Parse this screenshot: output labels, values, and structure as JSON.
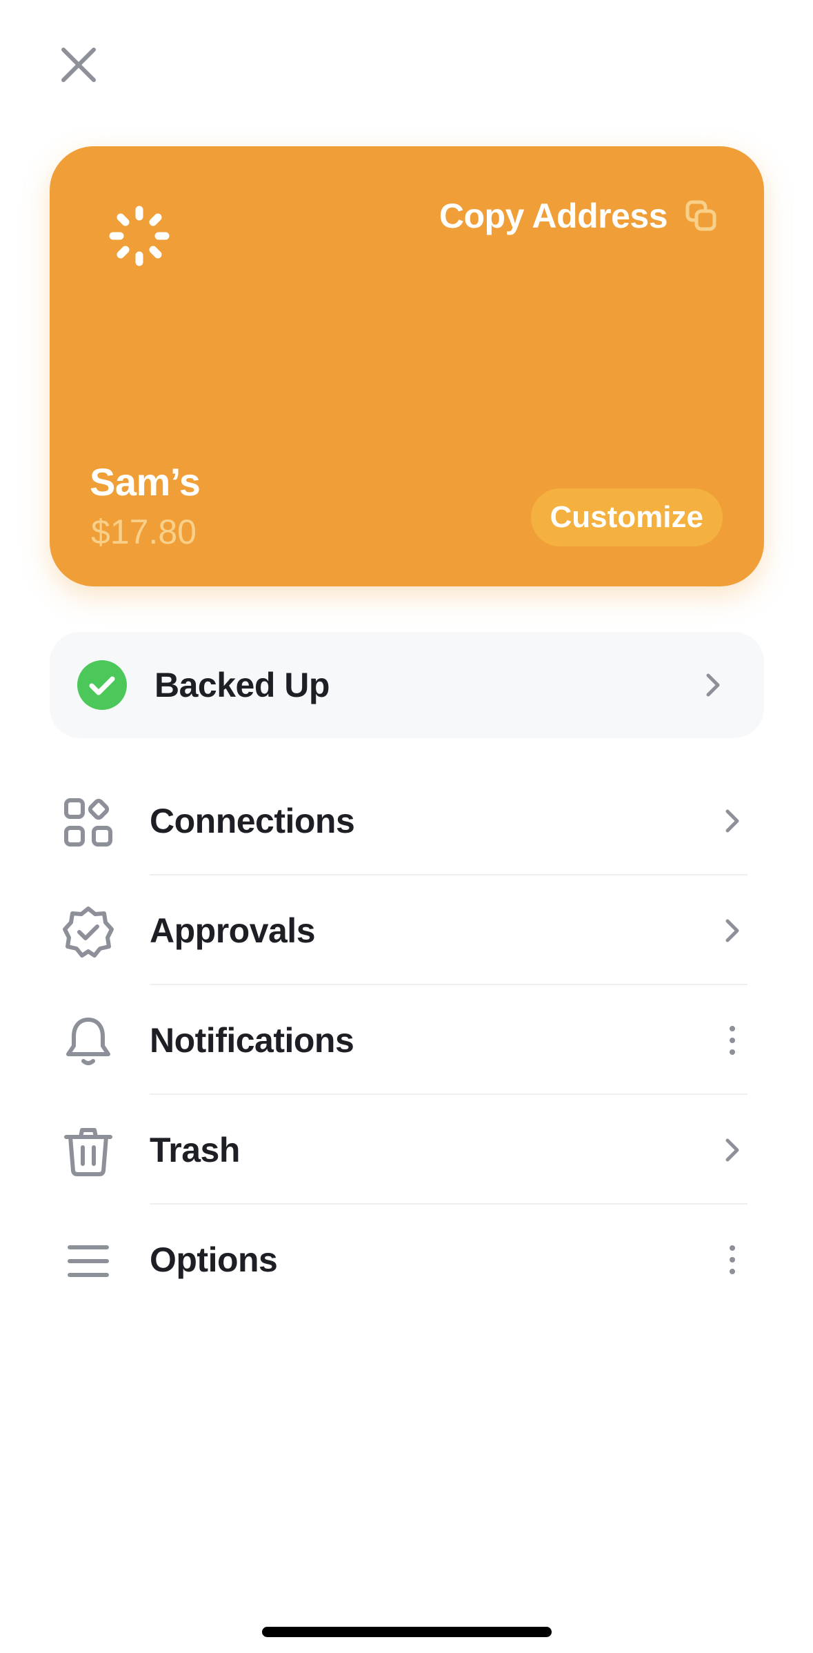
{
  "header": {
    "close_icon": "close-icon"
  },
  "wallet": {
    "card_color": "#f09f38",
    "avatar_icon": "loading-spinner-icon",
    "copy_address_label": "Copy Address",
    "copy_icon": "copy-icon",
    "name": "Sam’s",
    "balance": "$17.80",
    "customize_label": "Customize"
  },
  "backup": {
    "label": "Backed Up",
    "status_icon": "check-circle-icon",
    "status_color": "#4cc85a",
    "chevron_icon": "chevron-right-icon"
  },
  "menu": {
    "items": [
      {
        "id": "connections",
        "label": "Connections",
        "icon": "grid-icon",
        "trailing": "chevron-right-icon"
      },
      {
        "id": "approvals",
        "label": "Approvals",
        "icon": "badge-check-icon",
        "trailing": "chevron-right-icon"
      },
      {
        "id": "notifications",
        "label": "Notifications",
        "icon": "bell-icon",
        "trailing": "more-vertical-icon"
      },
      {
        "id": "trash",
        "label": "Trash",
        "icon": "trash-icon",
        "trailing": "chevron-right-icon"
      },
      {
        "id": "options",
        "label": "Options",
        "icon": "menu-lines-icon",
        "trailing": "more-vertical-icon"
      }
    ]
  }
}
